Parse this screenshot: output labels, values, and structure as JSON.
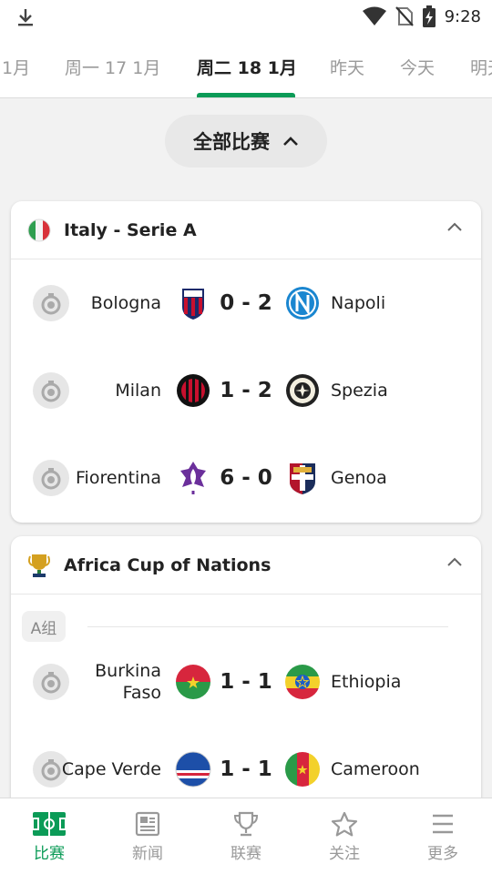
{
  "status_bar": {
    "time": "9:28"
  },
  "date_tabs": [
    {
      "label": "1月",
      "active": false
    },
    {
      "label": "周一 17 1月",
      "active": false
    },
    {
      "label": "周二 18 1月",
      "active": true
    },
    {
      "label": "昨天",
      "active": false
    },
    {
      "label": "今天",
      "active": false
    },
    {
      "label": "明天",
      "active": false
    }
  ],
  "filter": {
    "label": "全部比赛"
  },
  "leagues": [
    {
      "name": "Italy - Serie A",
      "matches": [
        {
          "home": "Bologna",
          "score": "0 - 2",
          "away": "Napoli"
        },
        {
          "home": "Milan",
          "score": "1 - 2",
          "away": "Spezia"
        },
        {
          "home": "Fiorentina",
          "score": "6 - 0",
          "away": "Genoa"
        }
      ]
    },
    {
      "name": "Africa Cup of Nations",
      "group": "A组",
      "matches": [
        {
          "home": "Burkina Faso",
          "score": "1 - 1",
          "away": "Ethiopia"
        },
        {
          "home": "Cape Verde",
          "score": "1 - 1",
          "away": "Cameroon"
        }
      ]
    }
  ],
  "bottom_nav": [
    {
      "label": "比赛",
      "icon": "pitch-icon",
      "active": true
    },
    {
      "label": "新闻",
      "icon": "news-icon",
      "active": false
    },
    {
      "label": "联赛",
      "icon": "trophy-icon",
      "active": false
    },
    {
      "label": "关注",
      "icon": "star-icon",
      "active": false
    },
    {
      "label": "更多",
      "icon": "menu-icon",
      "active": false
    }
  ],
  "colors": {
    "accent": "#0b9b57",
    "inactive": "#999999"
  }
}
